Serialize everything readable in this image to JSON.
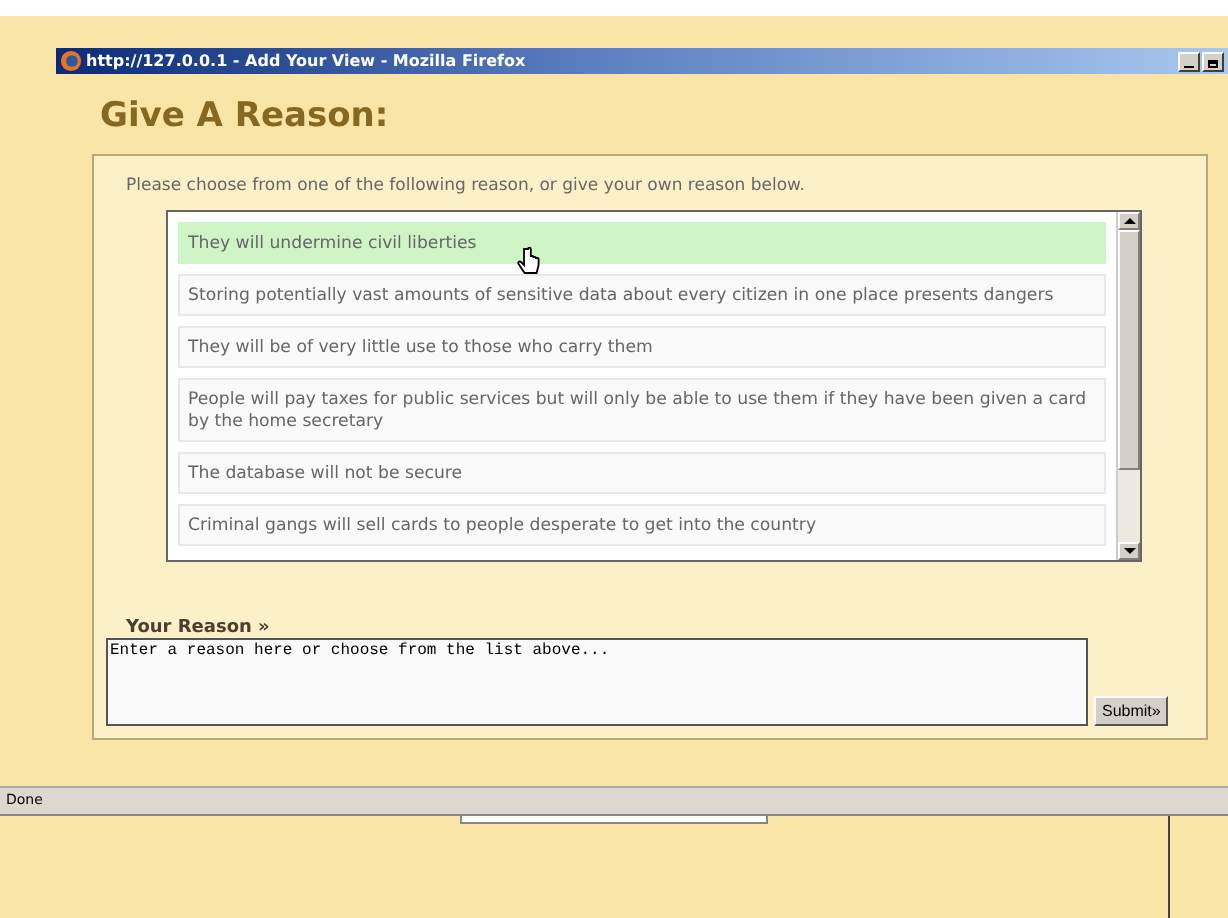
{
  "window": {
    "title": "http://127.0.0.1 - Add Your View - Mozilla Firefox"
  },
  "heading": "Give A Reason:",
  "instruction": "Please choose from one of the following reason, or give your own reason below.",
  "reasons": [
    {
      "text": "They will undermine civil liberties",
      "selected": true
    },
    {
      "text": "Storing potentially vast amounts of sensitive data about every citizen in one place presents dangers",
      "selected": false
    },
    {
      "text": "They will be of very little use to those who carry them",
      "selected": false
    },
    {
      "text": "People will pay taxes for public services but will only be able to use them if they have been given a card by the home secretary",
      "selected": false
    },
    {
      "text": "The database will not be secure",
      "selected": false
    },
    {
      "text": "Criminal gangs will sell cards to people desperate to get into the country",
      "selected": false
    }
  ],
  "your_reason": {
    "label": "Your Reason »",
    "value": "Enter a reason here or choose from the list above..."
  },
  "submit": "Submit»",
  "status_bar": "Done"
}
